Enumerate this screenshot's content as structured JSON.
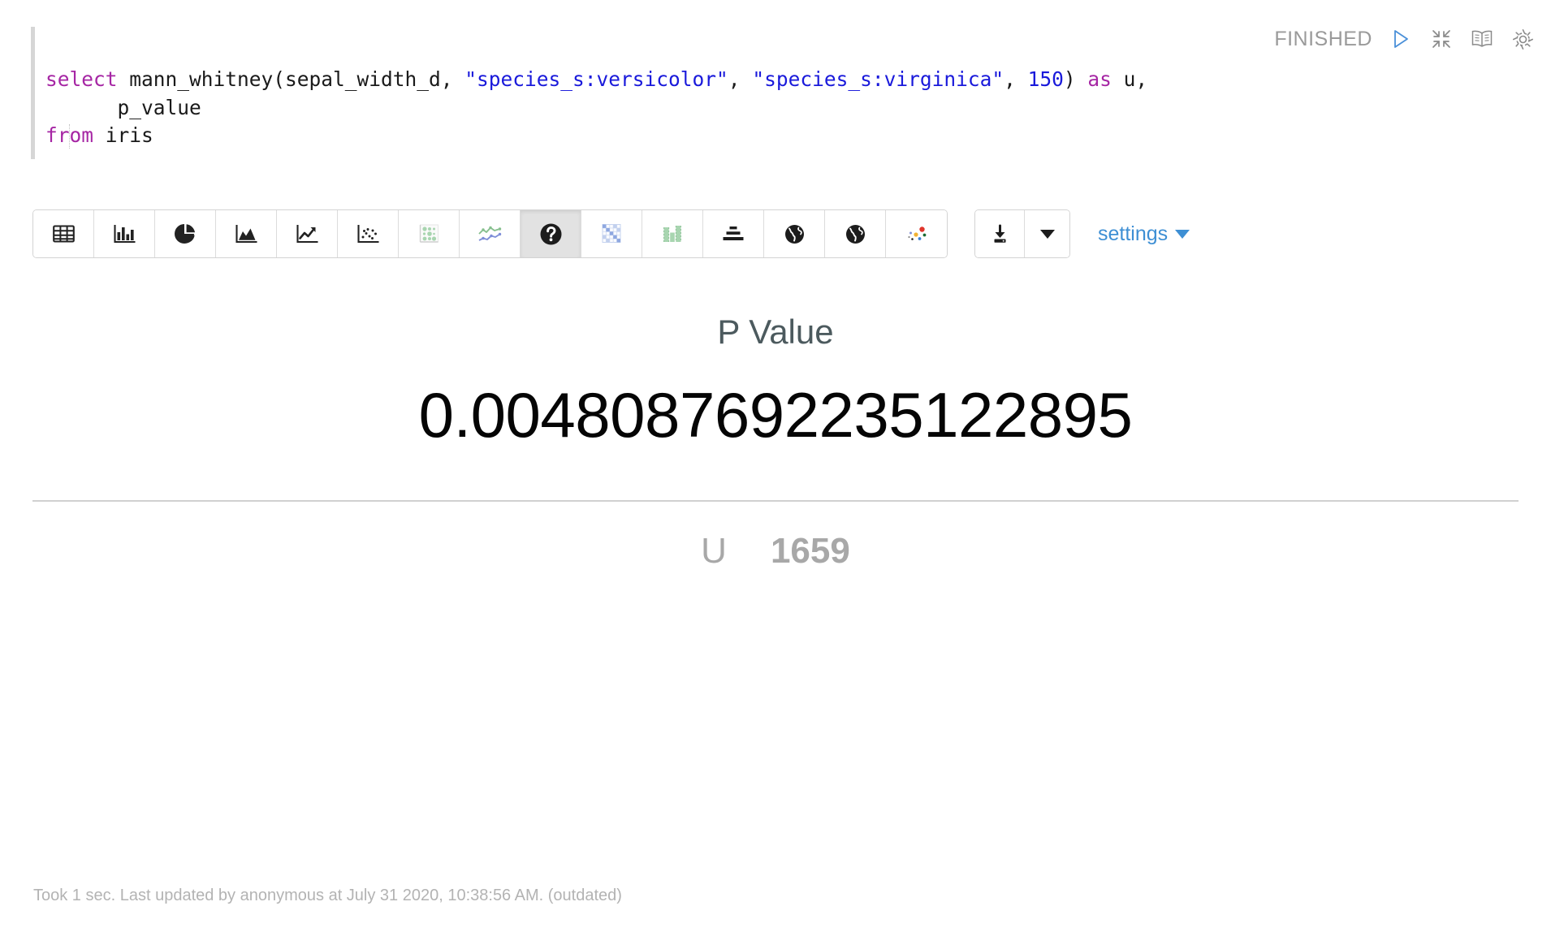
{
  "header": {
    "status": "FINISHED",
    "icons": [
      {
        "name": "run-icon",
        "title": "Run"
      },
      {
        "name": "collapse-icon",
        "title": "Collapse"
      },
      {
        "name": "book-icon",
        "title": "Docs"
      },
      {
        "name": "gear-icon",
        "title": "Settings"
      }
    ]
  },
  "editor": {
    "lines": [
      [
        {
          "t": "select",
          "c": "kw"
        },
        {
          "t": " mann_whitney(sepal_width_d, ",
          "c": "plain"
        },
        {
          "t": "\"species_s:versicolor\"",
          "c": "str"
        },
        {
          "t": ", ",
          "c": "plain"
        },
        {
          "t": "\"species_s:virginica\"",
          "c": "str"
        },
        {
          "t": ", ",
          "c": "plain"
        },
        {
          "t": "150",
          "c": "num"
        },
        {
          "t": ") ",
          "c": "plain"
        },
        {
          "t": "as",
          "c": "kw"
        },
        {
          "t": " u,",
          "c": "plain"
        }
      ],
      [
        {
          "t": "      p_value",
          "c": "plain"
        }
      ],
      [
        {
          "t": "from",
          "c": "kw"
        },
        {
          "t": " iris",
          "c": "plain"
        }
      ]
    ]
  },
  "toolbar": {
    "buttons": [
      {
        "name": "table-icon",
        "label": "Table",
        "active": false
      },
      {
        "name": "bar-chart-icon",
        "label": "Bar Chart",
        "active": false
      },
      {
        "name": "pie-chart-icon",
        "label": "Pie Chart",
        "active": false
      },
      {
        "name": "area-chart-icon",
        "label": "Area Chart",
        "active": false
      },
      {
        "name": "line-chart-icon",
        "label": "Line Chart",
        "active": false
      },
      {
        "name": "scatter-plot-icon",
        "label": "Scatter Plot",
        "active": false
      },
      {
        "name": "bubble-chart-icon",
        "label": "Bubble Chart",
        "active": false
      },
      {
        "name": "multi-line-chart-icon",
        "label": "Multi Line Chart",
        "active": false
      },
      {
        "name": "help-circle-icon",
        "label": "Statistic",
        "active": true
      },
      {
        "name": "matrix-grid-icon",
        "label": "Matrix",
        "active": false
      },
      {
        "name": "column-chart-icon",
        "label": "Column Chart",
        "active": false
      },
      {
        "name": "funnel-icon",
        "label": "Funnel",
        "active": false
      },
      {
        "name": "globe-icon",
        "label": "Map",
        "active": false
      },
      {
        "name": "globe-alt-icon",
        "label": "Geo Map",
        "active": false
      },
      {
        "name": "dot-cluster-icon",
        "label": "Cluster",
        "active": false
      }
    ],
    "download_label": "Download",
    "download_caret_label": "Download options",
    "settings_label": "settings"
  },
  "result": {
    "p_label": "P Value",
    "p_value": "0.0048087692235122895",
    "u_label": "U",
    "u_value": "1659"
  },
  "footer": {
    "text": "Took 1 sec. Last updated by anonymous at July 31 2020, 10:38:56 AM. (outdated)"
  },
  "colors": {
    "keyword": "#a626a4",
    "string": "#1a1adb",
    "number": "#1a1adb",
    "link": "#3e8fd4",
    "status": "#9a9a9a",
    "p_label": "#4c5a5e",
    "u_gray": "#a8a8a8",
    "active_button_bg": "#e2e2e2"
  }
}
